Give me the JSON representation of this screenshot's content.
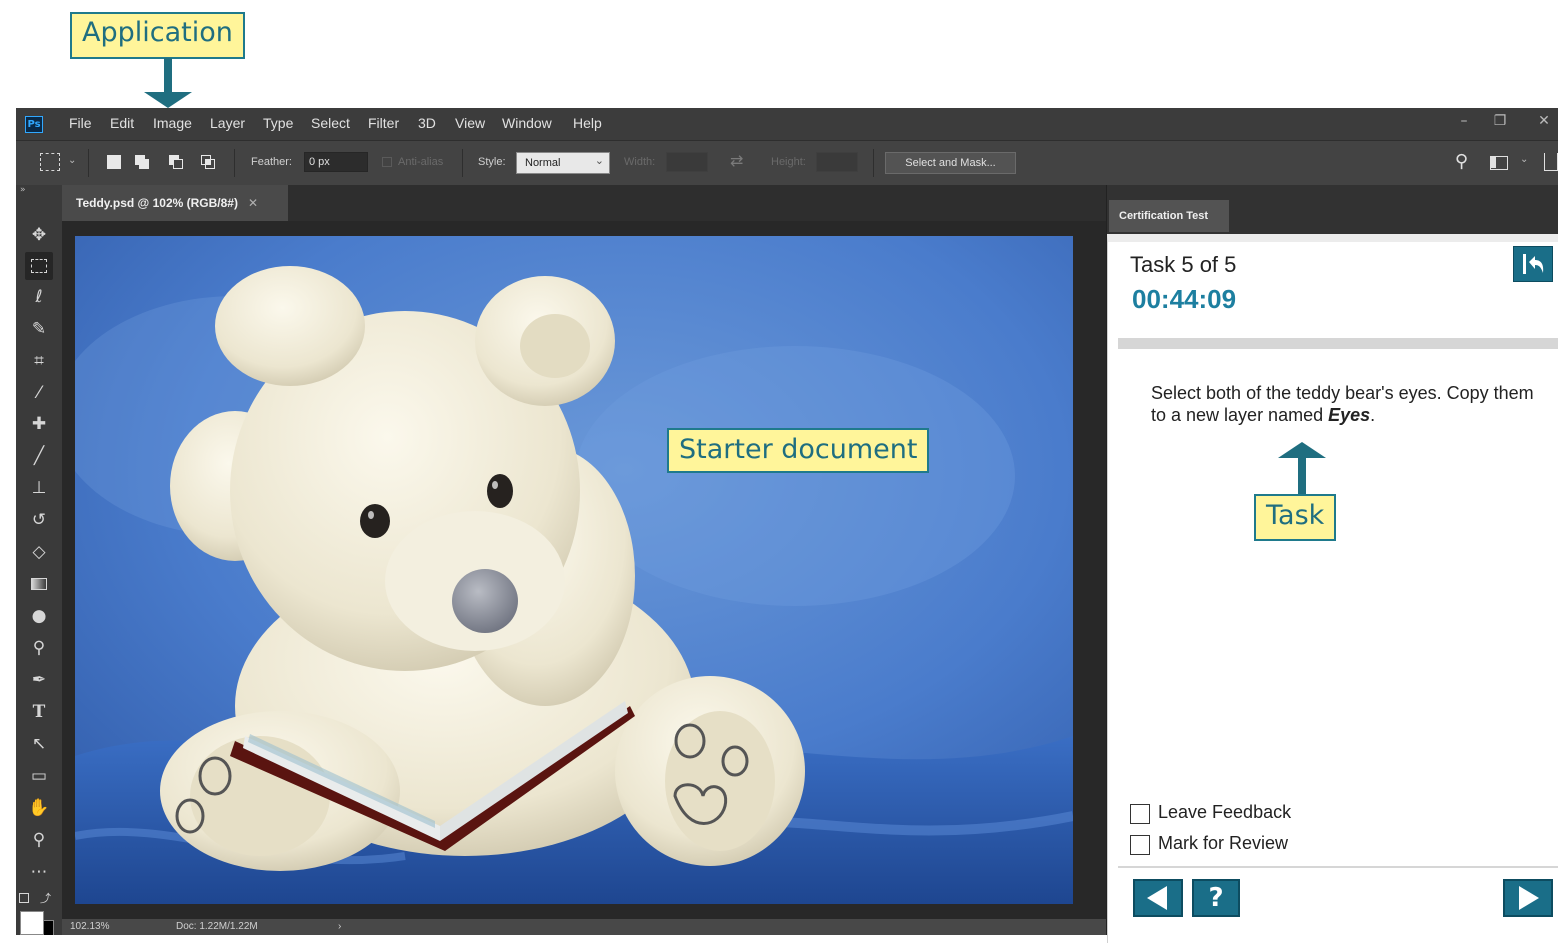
{
  "annotations": {
    "application": "Application",
    "starter_document": "Starter document",
    "task": "Task"
  },
  "app": {
    "logo": "Ps",
    "menu": [
      "File",
      "Edit",
      "Image",
      "Layer",
      "Type",
      "Select",
      "Filter",
      "3D",
      "View",
      "Window",
      "Help"
    ],
    "window_controls": [
      "minimize-icon",
      "restore-icon",
      "close-icon"
    ]
  },
  "options_bar": {
    "feather_label": "Feather:",
    "feather_value": "0 px",
    "antialias_label": "Anti-alias",
    "style_label": "Style:",
    "style_value": "Normal",
    "width_label": "Width:",
    "height_label": "Height:",
    "select_mask_label": "Select and Mask..."
  },
  "tools": [
    "move-tool-icon",
    "marquee-tool-icon",
    "lasso-tool-icon",
    "quick-selection-tool-icon",
    "crop-tool-icon",
    "eyedropper-tool-icon",
    "healing-brush-tool-icon",
    "brush-tool-icon",
    "clone-stamp-tool-icon",
    "history-brush-tool-icon",
    "eraser-tool-icon",
    "gradient-tool-icon",
    "blur-tool-icon",
    "dodge-tool-icon",
    "pen-tool-icon",
    "type-tool-icon",
    "path-selection-tool-icon",
    "rectangle-tool-icon",
    "hand-tool-icon",
    "zoom-tool-icon",
    "more-tools-icon"
  ],
  "document": {
    "tab_title": "Teddy.psd @ 102% (RGB/8#)",
    "zoom": "102.13%",
    "doc_size": "Doc: 1.22M/1.22M"
  },
  "panel": {
    "tab_label": "Certification Test"
  },
  "certification": {
    "task_counter": "Task 5 of 5",
    "timer": "00:44:09",
    "instruction_prefix": "Select both of the teddy bear's eyes. Copy them to a new layer named ",
    "instruction_emphasis": "Eyes",
    "instruction_suffix": ".",
    "leave_feedback_label": "Leave Feedback",
    "mark_review_label": "Mark for Review",
    "leave_feedback_checked": false,
    "mark_review_checked": false
  },
  "colors": {
    "accent": "#1a6e88",
    "timer": "#1d7fa0",
    "callout_fill": "#fff59a",
    "callout_border": "#1f7a8c"
  }
}
